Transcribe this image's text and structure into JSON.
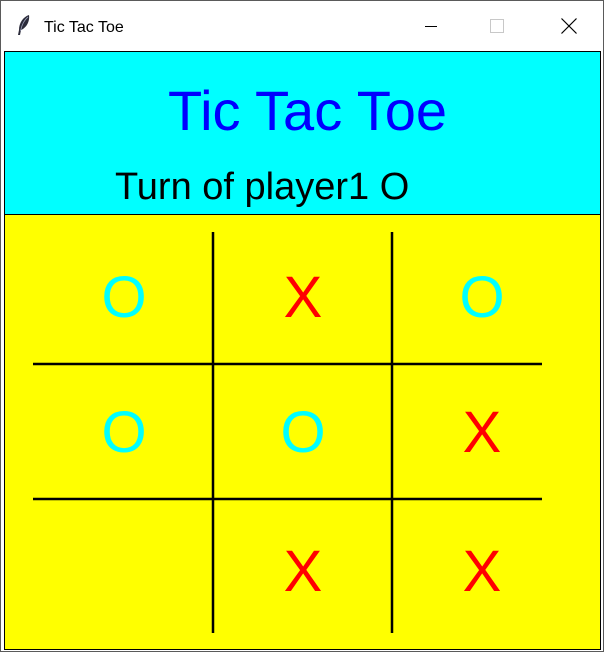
{
  "window": {
    "title": "Tic Tac Toe"
  },
  "header": {
    "title": "Tic Tac Toe",
    "turn_text": "Turn of player1 O",
    "background": "#00ffff",
    "title_color": "#0000ff"
  },
  "board": {
    "background": "#ffff00",
    "o_color": "#00ffff",
    "x_color": "#ff0000",
    "cells": [
      [
        "O",
        "X",
        "O"
      ],
      [
        "O",
        "O",
        "X"
      ],
      [
        "",
        "X",
        "X"
      ]
    ]
  }
}
